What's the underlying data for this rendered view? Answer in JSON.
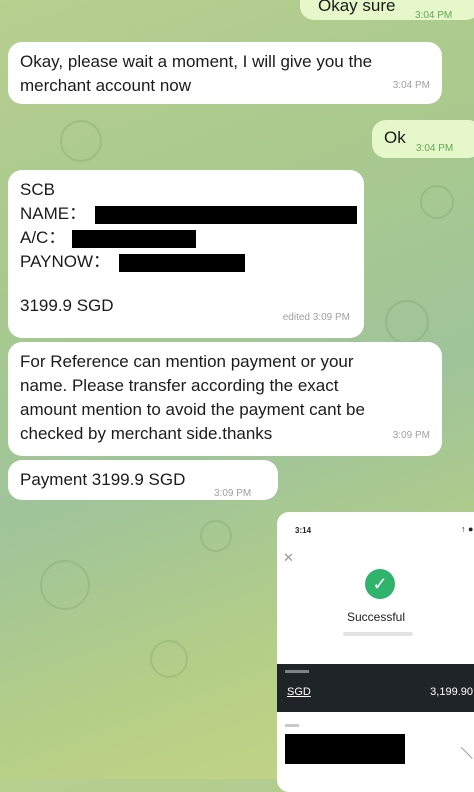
{
  "messages": {
    "top_reply": {
      "text": "Okay sure",
      "time": "3:04 PM"
    },
    "wait": {
      "line1": "Okay, please wait a moment, I will give you the",
      "line2": "merchant account now",
      "time": "3:04 PM"
    },
    "ok": {
      "text": "Ok",
      "time": "3:04 PM"
    },
    "account": {
      "bank": "SCB",
      "name_label": "NAME：",
      "ac_label": "A/C：",
      "paynow_label": "PAYNOW：",
      "amount": "3199.9  SGD",
      "time": "edited 3:09 PM"
    },
    "reference": {
      "line1": "For Reference can mention payment or your",
      "line2": "name. Please transfer according the exact",
      "line3": "amount mention to avoid the payment cant be",
      "line4": "checked by merchant side.thanks",
      "time": "3:09 PM"
    },
    "payment": {
      "text": "Payment 3199.9 SGD",
      "time": "3:09 PM"
    }
  },
  "screenshot": {
    "status_time": "3:14",
    "status_icons": "↑ ● 5",
    "close": "✕",
    "eye_label": "◎",
    "status": "Successful",
    "currency": "SGD",
    "amount": "3,199.90"
  },
  "icons": {
    "check": "check-icon",
    "close": "close-icon",
    "eye": "eye-icon"
  },
  "colors": {
    "incoming_bubble": "#ffffff",
    "outgoing_bubble": "#e6f7c9",
    "success_green": "#2fb36d"
  }
}
